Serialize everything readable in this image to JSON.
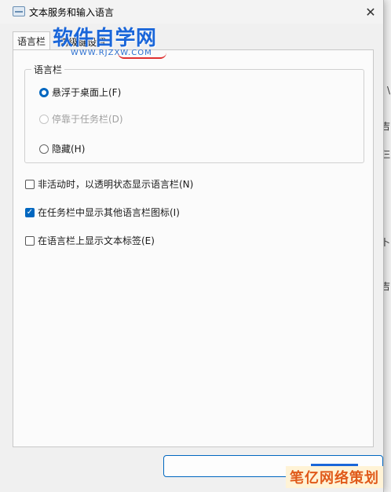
{
  "window": {
    "title": "文本服务和输入语言",
    "close_glyph": "✕"
  },
  "tabs": [
    {
      "label": "语言栏",
      "active": true
    },
    {
      "label": "高级键设置",
      "active": false
    }
  ],
  "language_bar_group": {
    "legend": "语言栏",
    "options": [
      {
        "label": "悬浮于桌面上(F)",
        "checked": true,
        "disabled": false
      },
      {
        "label": "停靠于任务栏(D)",
        "checked": false,
        "disabled": true
      },
      {
        "label": "隐藏(H)",
        "checked": false,
        "disabled": false
      }
    ]
  },
  "checkboxes": [
    {
      "label": "非活动时，以透明状态显示语言栏(N)",
      "checked": false
    },
    {
      "label": "在任务栏中显示其他语言栏图标(I)",
      "checked": true
    },
    {
      "label": "在语言栏上显示文本标签(E)",
      "checked": false
    }
  ],
  "watermarks": {
    "top_title": "软件自学网",
    "top_url": "WWW.RJZXW.COM",
    "bottom": "笔亿网络策划"
  },
  "right_strip_glyphs": [
    "\\",
    "吉",
    "仨",
    "卜",
    "吉"
  ],
  "colors": {
    "accent": "#0067c0",
    "watermark_blue": "#1a66d9",
    "watermark_orange": "#e05a1a"
  }
}
